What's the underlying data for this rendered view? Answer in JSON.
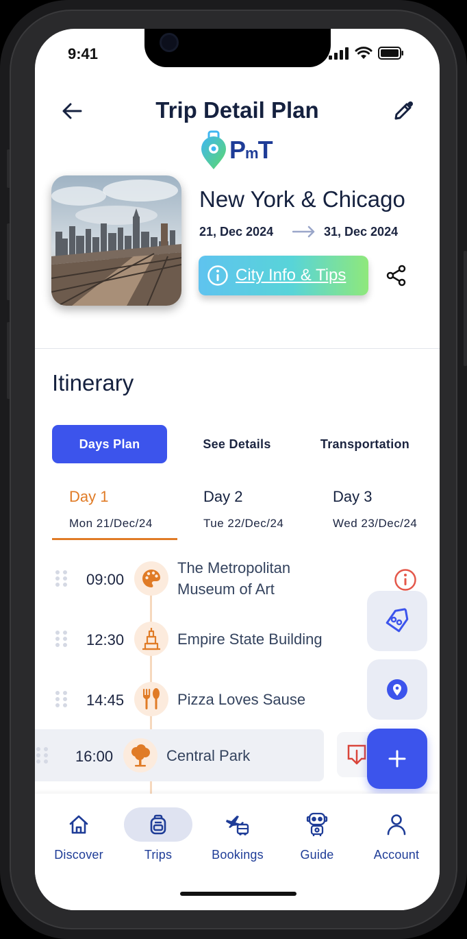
{
  "status_bar": {
    "time": "9:41"
  },
  "header": {
    "title": "Trip Detail Plan"
  },
  "logo": {
    "text_p": "P",
    "text_m": "m",
    "text_t": "T"
  },
  "trip": {
    "name": "New York & Chicago",
    "date_from": "21, Dec 2024",
    "date_to": "31, Dec 2024",
    "city_info_label": "City Info & Tips"
  },
  "itinerary": {
    "title": "Itinerary",
    "plan_tabs": [
      {
        "label": "Days Plan",
        "active": true
      },
      {
        "label": "See Details",
        "active": false
      },
      {
        "label": "Transportation",
        "active": false
      }
    ],
    "day_tabs": [
      {
        "day": "Day 1",
        "date": "Mon 21/Dec/24",
        "active": true
      },
      {
        "day": "Day 2",
        "date": "Tue 22/Dec/24",
        "active": false
      },
      {
        "day": "Day 3",
        "date": "Wed 23/Dec/24",
        "active": false
      }
    ],
    "activities": [
      {
        "time": "09:00",
        "name_line1": "The Metropolitan",
        "name_line2": "Museum of Art",
        "icon": "palette-icon"
      },
      {
        "time": "12:30",
        "name_line1": "Empire State Building",
        "name_line2": "",
        "icon": "building-icon"
      },
      {
        "time": "14:45",
        "name_line1": "Pizza Loves Sause",
        "name_line2": "",
        "icon": "restaurant-icon"
      },
      {
        "time": "16:00",
        "name_line1": "Central Park",
        "name_line2": "",
        "icon": "tree-icon"
      }
    ]
  },
  "bottom_nav": [
    {
      "label": "Discover",
      "icon": "home-icon",
      "active": false
    },
    {
      "label": "Trips",
      "icon": "backpack-icon",
      "active": true
    },
    {
      "label": "Bookings",
      "icon": "plane-bus-icon",
      "active": false
    },
    {
      "label": "Guide",
      "icon": "robot-icon",
      "active": false
    },
    {
      "label": "Account",
      "icon": "person-icon",
      "active": false
    }
  ],
  "colors": {
    "primary": "#3C54EC",
    "accent_orange": "#E07B26",
    "nav_blue": "#1E3C97",
    "info_red": "#E4574A"
  }
}
